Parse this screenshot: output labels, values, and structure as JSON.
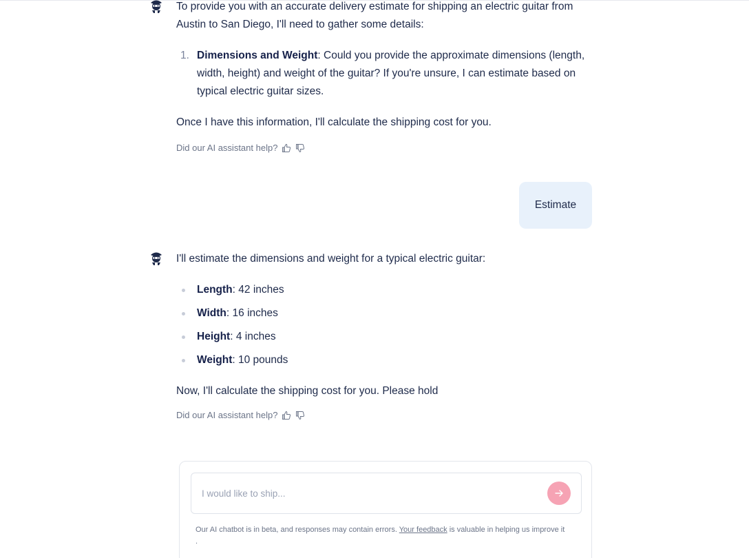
{
  "messages": [
    {
      "role": "assistant",
      "intro": "To provide you with an accurate delivery estimate for shipping an electric guitar from Austin to San Diego, I'll need to gather some details:",
      "list": [
        {
          "num": "1.",
          "term": "Dimensions and Weight",
          "text": ": Could you provide the approximate dimensions (length, width, height) and weight of the guitar? If you're unsure, I can estimate based on typical electric guitar sizes."
        }
      ],
      "outro": "Once I have this information, I'll calculate the shipping cost for you."
    },
    {
      "role": "user",
      "text": "Estimate"
    },
    {
      "role": "assistant",
      "intro": "I'll estimate the dimensions and weight for a typical electric guitar:",
      "bullets": [
        {
          "term": "Length",
          "text": ": 42 inches"
        },
        {
          "term": "Width",
          "text": ": 16 inches"
        },
        {
          "term": "Height",
          "text": ": 4 inches"
        },
        {
          "term": "Weight",
          "text": ": 10 pounds"
        }
      ],
      "outro": "Now, I'll calculate the shipping cost for you. Please hold"
    }
  ],
  "feedback": {
    "prompt": "Did our AI assistant help?",
    "icons": [
      "thumbs-up-icon",
      "thumbs-down-icon"
    ]
  },
  "composer": {
    "placeholder": "I would like to ship...",
    "value": "",
    "send_icon": "arrow-right-icon",
    "send_color": "#f6a3b4",
    "disclaimer_pre": "Our AI chatbot is in beta, and responses may contain errors. ",
    "disclaimer_link": "Your feedback",
    "disclaimer_post": " is valuable in helping us improve it ."
  },
  "colors": {
    "text": "#1e2a4a",
    "user_bubble": "#e8f1fb",
    "muted": "#6b7488"
  }
}
